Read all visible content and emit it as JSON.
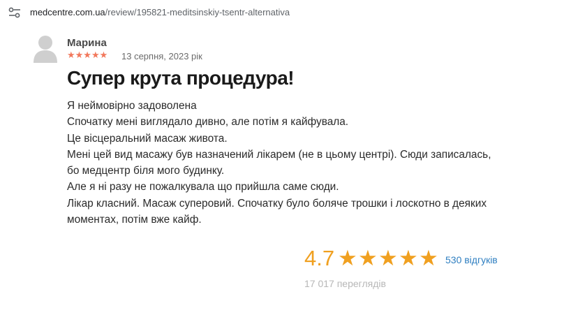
{
  "browser": {
    "url_domain": "medcentre.com.ua",
    "url_path": "/review/195821-meditsinskiy-tsentr-alternativa",
    "site_info_icon": "tune-icon"
  },
  "review": {
    "author": "Марина",
    "rating_stars": "★★★★★",
    "rating": 5,
    "date": "13 серпня, 2023 рік",
    "title": "Супер крута процедура!",
    "body_lines": [
      "Я неймовірно задоволена",
      "Спочатку мені виглядало дивно, але потім я кайфувала.",
      "Це вісцеральний масаж живота.",
      "Мені цей вид масажу був назначений лікарем (не в цьому центрі). Сюди записалась,",
      "бо медцентр біля мого будинку.",
      "Але я ні разу не пожалкувала що прийшла саме сюди.",
      "Лікар класний. Масаж суперовий. Спочатку було боляче трошки і лоскотно в деяких",
      "моментах, потім вже кайф."
    ],
    "avatar_icon": "user-avatar-icon",
    "star_color": "#f2785c"
  },
  "summary": {
    "average": "4.7",
    "stars": [
      "★",
      "★",
      "★",
      "★",
      "★"
    ],
    "reviews_count_label": "530 відгуків",
    "views_label": "17 017 переглядів",
    "accent_color": "#f0a020",
    "link_color": "#2f7fc1"
  }
}
